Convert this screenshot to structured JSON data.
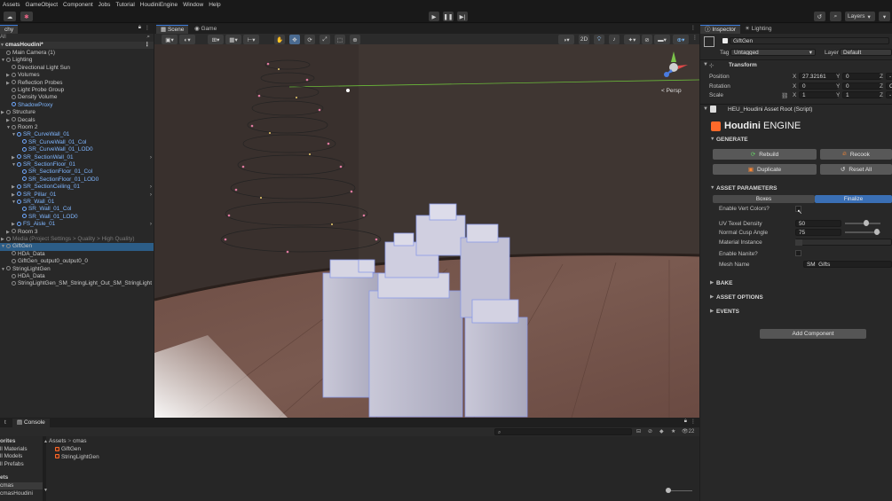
{
  "menu": [
    "Assets",
    "GameObject",
    "Component",
    "Jobs",
    "Tutorial",
    "HoudiniEngine",
    "Window",
    "Help"
  ],
  "toolbar": {
    "layers_label": "Layers"
  },
  "hierarchy": {
    "tab_label": "chy",
    "search_placeholder": "All",
    "scene_name": "cmasHoudini*",
    "items": [
      {
        "label": "Main Camera (1)",
        "indent": 1,
        "icon": "cube",
        "arrow": "",
        "style": ""
      },
      {
        "label": "Lighting",
        "indent": 1,
        "icon": "cube",
        "arrow": "▼",
        "style": ""
      },
      {
        "label": "Directional Light Sun",
        "indent": 2,
        "icon": "cube",
        "arrow": "",
        "style": ""
      },
      {
        "label": "Volumes",
        "indent": 2,
        "icon": "cube",
        "arrow": "▶",
        "style": ""
      },
      {
        "label": "Reflection Probes",
        "indent": 2,
        "icon": "cube",
        "arrow": "▶",
        "style": ""
      },
      {
        "label": "Light Probe Group",
        "indent": 2,
        "icon": "cube",
        "arrow": "",
        "style": ""
      },
      {
        "label": "Density Volume",
        "indent": 2,
        "icon": "cube",
        "arrow": "",
        "style": ""
      },
      {
        "label": "ShadowProxy",
        "indent": 2,
        "icon": "blue",
        "arrow": "",
        "style": "blue"
      },
      {
        "label": "Structure",
        "indent": 1,
        "icon": "cube",
        "arrow": "▶",
        "style": ""
      },
      {
        "label": "Decals",
        "indent": 2,
        "icon": "cube",
        "arrow": "▶",
        "style": ""
      },
      {
        "label": "Room 2",
        "indent": 2,
        "icon": "cube",
        "arrow": "▼",
        "style": ""
      },
      {
        "label": "SR_CurveWall_01",
        "indent": 3,
        "icon": "blue",
        "arrow": "▼",
        "style": "blue"
      },
      {
        "label": "SR_CurveWall_01_Col",
        "indent": 4,
        "icon": "blue",
        "arrow": "",
        "style": "blue"
      },
      {
        "label": "SR_CurveWall_01_LOD0",
        "indent": 4,
        "icon": "blue",
        "arrow": "",
        "style": "blue"
      },
      {
        "label": "SR_SectionWall_01",
        "indent": 3,
        "icon": "blue",
        "arrow": "▶",
        "style": "blue"
      },
      {
        "label": "SR_SectionFloor_01",
        "indent": 3,
        "icon": "blue",
        "arrow": "▼",
        "style": "blue"
      },
      {
        "label": "SR_SectionFloor_01_Col",
        "indent": 4,
        "icon": "blue",
        "arrow": "",
        "style": "blue"
      },
      {
        "label": "SR_SectionFloor_01_LOD0",
        "indent": 4,
        "icon": "blue",
        "arrow": "",
        "style": "blue"
      },
      {
        "label": "SR_SectionCeiling_01",
        "indent": 3,
        "icon": "blue",
        "arrow": "▶",
        "style": "blue"
      },
      {
        "label": "SR_Pillar_01",
        "indent": 3,
        "icon": "blue",
        "arrow": "▶",
        "style": "blue"
      },
      {
        "label": "SR_Wall_01",
        "indent": 3,
        "icon": "blue",
        "arrow": "▼",
        "style": "blue"
      },
      {
        "label": "SR_Wall_01_Col",
        "indent": 4,
        "icon": "blue",
        "arrow": "",
        "style": "blue"
      },
      {
        "label": "SR_Wall_01_LOD0",
        "indent": 4,
        "icon": "blue",
        "arrow": "",
        "style": "blue"
      },
      {
        "label": "FS_Aisle_01",
        "indent": 3,
        "icon": "blue",
        "arrow": "▶",
        "style": "blue"
      },
      {
        "label": "Room 3",
        "indent": 2,
        "icon": "cube",
        "arrow": "▶",
        "style": ""
      },
      {
        "label": "Media (Project Settings > Quality > High Quality)",
        "indent": 1,
        "icon": "cube",
        "arrow": "▶",
        "style": "dim"
      },
      {
        "label": "GiftGen",
        "indent": 1,
        "icon": "cube",
        "arrow": "▼",
        "style": "sel"
      },
      {
        "label": "HDA_Data",
        "indent": 2,
        "icon": "cube",
        "arrow": "",
        "style": ""
      },
      {
        "label": "GiftGen_output0_output0_0",
        "indent": 2,
        "icon": "cube",
        "arrow": "",
        "style": ""
      },
      {
        "label": "StringLightGen",
        "indent": 1,
        "icon": "cube",
        "arrow": "▼",
        "style": ""
      },
      {
        "label": "HDA_Data",
        "indent": 2,
        "icon": "cube",
        "arrow": "",
        "style": ""
      },
      {
        "label": "StringLightGen_SM_StringLight_Out_SM_StringLight",
        "indent": 2,
        "icon": "cube",
        "arrow": "",
        "style": ""
      }
    ]
  },
  "scene_view": {
    "tabs": [
      "Scene",
      "Game"
    ],
    "toggle_2d": "2D",
    "persp_label": "< Persp",
    "gizmo_axes": [
      "y",
      "x",
      "z"
    ]
  },
  "inspector": {
    "tabs": [
      "Inspector",
      "Lighting"
    ],
    "object_name": "GiftGen",
    "tag_label": "Tag",
    "tag_value": "Untagged",
    "layer_label": "Layer",
    "layer_value": "Default",
    "transform_title": "Transform",
    "transform": [
      {
        "label": "Position",
        "x": "27.32161",
        "y": "0",
        "z": "-"
      },
      {
        "label": "Rotation",
        "x": "0",
        "y": "0",
        "z": "C"
      },
      {
        "label": "Scale",
        "x": "1",
        "y": "1",
        "z": "-"
      }
    ],
    "axis_labels": [
      "X",
      "Y",
      "Z"
    ],
    "script_title": "HEU_Houdini Asset Root (Script)",
    "brand_bold": "Houdini",
    "brand_rest": "ENGINE",
    "generate_title": "GENERATE",
    "buttons": {
      "rebuild": "Rebuild",
      "recook": "Recook",
      "duplicate": "Duplicate",
      "reset_all": "Reset All"
    },
    "asset_params_title": "ASSET PARAMETERS",
    "param_tabs": [
      "Boxes",
      "Finalize"
    ],
    "params": {
      "enable_vert_colors": "Enable Vert Colors?",
      "uv_texel_density": "UV Texel Density",
      "uv_texel_density_value": "50",
      "normal_cusp_angle": "Normal Cusp Angle",
      "normal_cusp_angle_value": "75",
      "material_instance": "Material Instance",
      "enable_nanite": "Enable Nanite?",
      "mesh_name": "Mesh Name",
      "mesh_name_value": "SM_Gifts"
    },
    "uv_slider_fraction": 0.6,
    "cusp_slider_fraction": 0.9,
    "sections": [
      "BAKE",
      "ASSET OPTIONS",
      "EVENTS"
    ],
    "add_component": "Add Component"
  },
  "project": {
    "tabs": [
      "t",
      "Console"
    ],
    "favorites_title": "orites",
    "favorites": [
      "ll Materials",
      "ll Models",
      "ll Prefabs"
    ],
    "assets_title": "ets",
    "assets_items": [
      "cmas",
      "cmasHoudini"
    ],
    "breadcrumb": [
      "Assets",
      "cmas"
    ],
    "files": [
      "GiftGen",
      "StringLightGen"
    ],
    "count": "22"
  },
  "colors": {
    "accent": "#3a7ad8",
    "selection": "#2c5d87",
    "link": "#7fb6ff",
    "houdini_orange": "#ff6a2a"
  }
}
